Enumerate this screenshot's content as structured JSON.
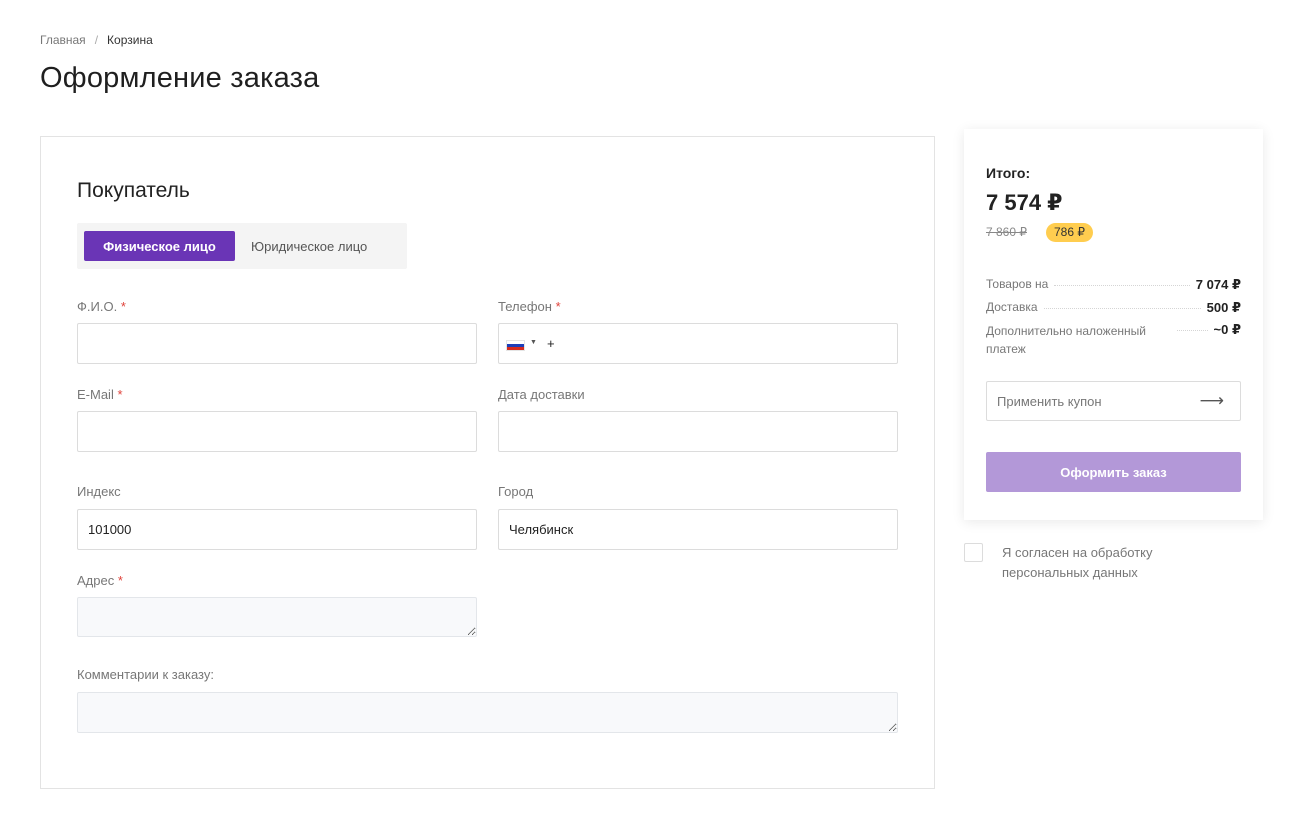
{
  "breadcrumb": {
    "home": "Главная",
    "separator": "/",
    "current": "Корзина"
  },
  "page_title": "Оформление заказа",
  "buyer": {
    "section_title": "Покупатель",
    "type_options": {
      "individual": "Физическое лицо",
      "legal": "Юридическое лицо"
    },
    "required_mark": "*",
    "fields": {
      "name": {
        "label": "Ф.И.О.",
        "value": ""
      },
      "phone": {
        "label": "Телефон",
        "code": "+",
        "value": ""
      },
      "email": {
        "label": "E-Mail",
        "value": ""
      },
      "delivery_date": {
        "label": "Дата доставки",
        "value": ""
      },
      "index": {
        "label": "Индекс",
        "value": "101000"
      },
      "city": {
        "label": "Город",
        "value": "Челябинск"
      },
      "address": {
        "label": "Адрес",
        "value": ""
      },
      "comment": {
        "label": "Комментарии к заказу:",
        "value": ""
      }
    }
  },
  "summary": {
    "label": "Итого:",
    "total": "7 574 ₽",
    "old_total": "7 860 ₽",
    "discount": "786 ₽",
    "rows": [
      {
        "label": "Товаров на",
        "value": "7 074 ₽"
      },
      {
        "label": "Доставка",
        "value": "500 ₽"
      },
      {
        "label": "Дополнительно наложенный платеж",
        "value": "~0 ₽"
      }
    ],
    "coupon_placeholder": "Применить купон",
    "order_button": "Оформить заказ"
  },
  "agreement": {
    "text": "Я согласен на обработку персональных данных"
  },
  "colors": {
    "accent": "#6a35b6",
    "order_button": "#b398d8",
    "discount_badge": "#ffcd4f",
    "required": "#e0423a"
  },
  "icons": {
    "coupon_submit": "arrow-right-icon",
    "phone_country": "russia-flag-icon"
  }
}
